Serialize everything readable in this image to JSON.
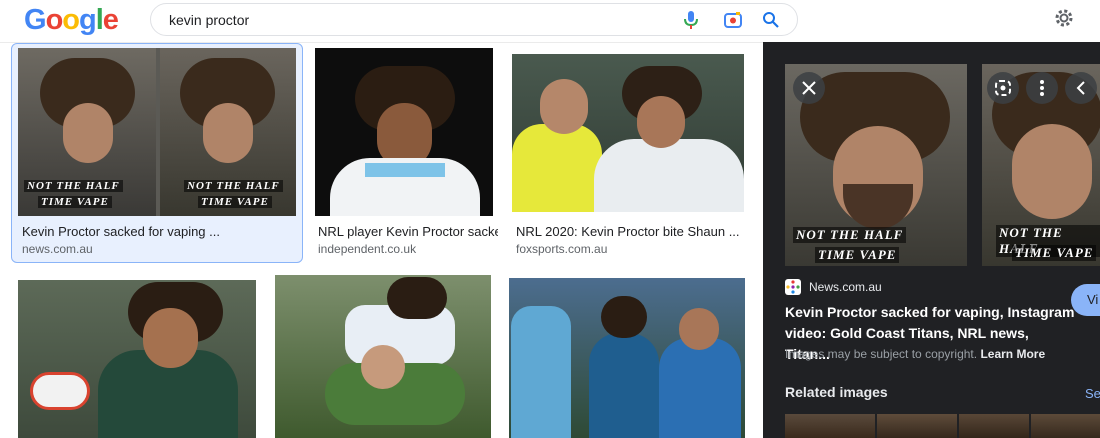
{
  "header": {
    "logo_letters": [
      {
        "ch": "G",
        "color": "#4285F4"
      },
      {
        "ch": "o",
        "color": "#EA4335"
      },
      {
        "ch": "o",
        "color": "#FBBC05"
      },
      {
        "ch": "g",
        "color": "#4285F4"
      },
      {
        "ch": "l",
        "color": "#34A853"
      },
      {
        "ch": "e",
        "color": "#EA4335"
      }
    ],
    "search_query": "kevin proctor",
    "icons": [
      "mic-icon",
      "lens-icon",
      "search-icon",
      "gear-icon"
    ]
  },
  "results": [
    {
      "title": "Kevin Proctor sacked for vaping ...",
      "source": "news.com.au",
      "caption_1": "NOT THE HALF",
      "caption_2": "TIME VAPE"
    },
    {
      "title": "NRL player Kevin Proctor sacke...",
      "source": "independent.co.uk"
    },
    {
      "title": "NRL 2020: Kevin Proctor bite Shaun ...",
      "source": "foxsports.com.au"
    },
    {
      "title": "",
      "source": ""
    },
    {
      "title": "",
      "source": ""
    },
    {
      "title": "",
      "source": ""
    }
  ],
  "panel": {
    "source_name": "News.com.au",
    "title": "Kevin Proctor sacked for vaping, Instagram video: Gold Coast Titans, NRL news, Titan...",
    "copyright_text": "Images may be subject to copyright.",
    "learn_more": "Learn More",
    "visit_label": "Vi",
    "related_label": "Related images",
    "see_all": "Se",
    "caption_1": "NOT THE HALF",
    "caption_2": "TIME VAPE"
  },
  "colors": {
    "accent_blue": "#1a73e8",
    "panel_bg": "#202124",
    "selected_border": "#8ab4f8"
  }
}
